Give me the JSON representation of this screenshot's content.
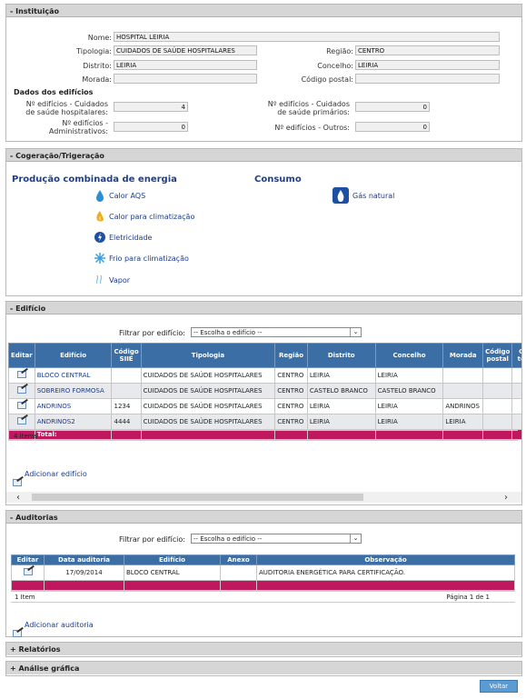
{
  "inst": {
    "title": "- Instituição",
    "nome_l": "Nome:",
    "nome": "HOSPITAL LEIRIA",
    "tipologia_l": "Tipologia:",
    "tipologia": "CUIDADOS DE SAÚDE HOSPITALARES",
    "regiao_l": "Região:",
    "regiao": "CENTRO",
    "distrito_l": "Distrito:",
    "distrito": "LEIRIA",
    "concelho_l": "Concelho:",
    "concelho": "LEIRIA",
    "morada_l": "Morada:",
    "morada": "",
    "cp_l": "Código postal:",
    "cp": "",
    "dados": "Dados dos edifícios",
    "e1_l": "Nº edifícios - Cuidados de saúde hospitalares:",
    "e1": "4",
    "e2_l": "Nº edifícios - Cuidados de saúde primários:",
    "e2": "0",
    "e3_l": "Nº edifícios - Administrativos:",
    "e3": "0",
    "e4_l": "Nº edifícios - Outros:",
    "e4": "0"
  },
  "cog": {
    "title": "- Cogeração/Trigeração",
    "prod": "Produção combinada de energia",
    "cons": "Consumo",
    "items": [
      "Calor AQS",
      "Calor para climatização",
      "Eletricidade",
      "Frio para climatização",
      "Vapor"
    ],
    "gas": "Gás natural"
  },
  "edif": {
    "title": "- Edifício",
    "filter_l": "Filtrar por edifício:",
    "filter": "-- Escolha o edifício --",
    "cols": [
      "Editar",
      "Edifício",
      "Código SIIE",
      "Tipologia",
      "Região",
      "Distrito",
      "Concelho",
      "Morada",
      "Código postal",
      "C te"
    ],
    "rows": [
      [
        "BLOCO CENTRAL",
        "",
        "CUIDADOS DE SAÚDE HOSPITALARES",
        "CENTRO",
        "LEIRIA",
        "LEIRIA",
        "",
        ""
      ],
      [
        "SOBREIRO FORMOSA",
        "",
        "CUIDADOS DE SAÚDE HOSPITALARES",
        "CENTRO",
        "CASTELO BRANCO",
        "CASTELO BRANCO",
        "",
        ""
      ],
      [
        "ANDRINOS",
        "1234",
        "CUIDADOS DE SAÚDE HOSPITALARES",
        "CENTRO",
        "LEIRIA",
        "LEIRIA",
        "ANDRINOS",
        ""
      ],
      [
        "ANDRINOS2",
        "4444",
        "CUIDADOS DE SAÚDE HOSPITALARES",
        "CENTRO",
        "LEIRIA",
        "LEIRIA",
        "LEIRIA",
        ""
      ]
    ],
    "total": "Total:",
    "count": "4 Items",
    "add": "Adicionar edifício"
  },
  "aud": {
    "title": "- Auditorias",
    "filter_l": "Filtrar por edifício:",
    "filter": "-- Escolha o edifício --",
    "cols": [
      "Editar",
      "Data auditoria",
      "Edifício",
      "Anexo",
      "Observação"
    ],
    "row": [
      "17/09/2014",
      "BLOCO CENTRAL",
      "",
      "AUDITORIA ENERGÉTICA PARA CERTIFICAÇÃO."
    ],
    "count": "1 Item",
    "page": "Página 1 de 1",
    "add": "Adicionar auditoria"
  },
  "rel": "+ Relatórios",
  "ana": "+ Análise gráfica",
  "voltar": "Voltar",
  "colors": {
    "header": "#3b6ea5",
    "total": "#c0185f",
    "title": "#1f3f8a"
  }
}
